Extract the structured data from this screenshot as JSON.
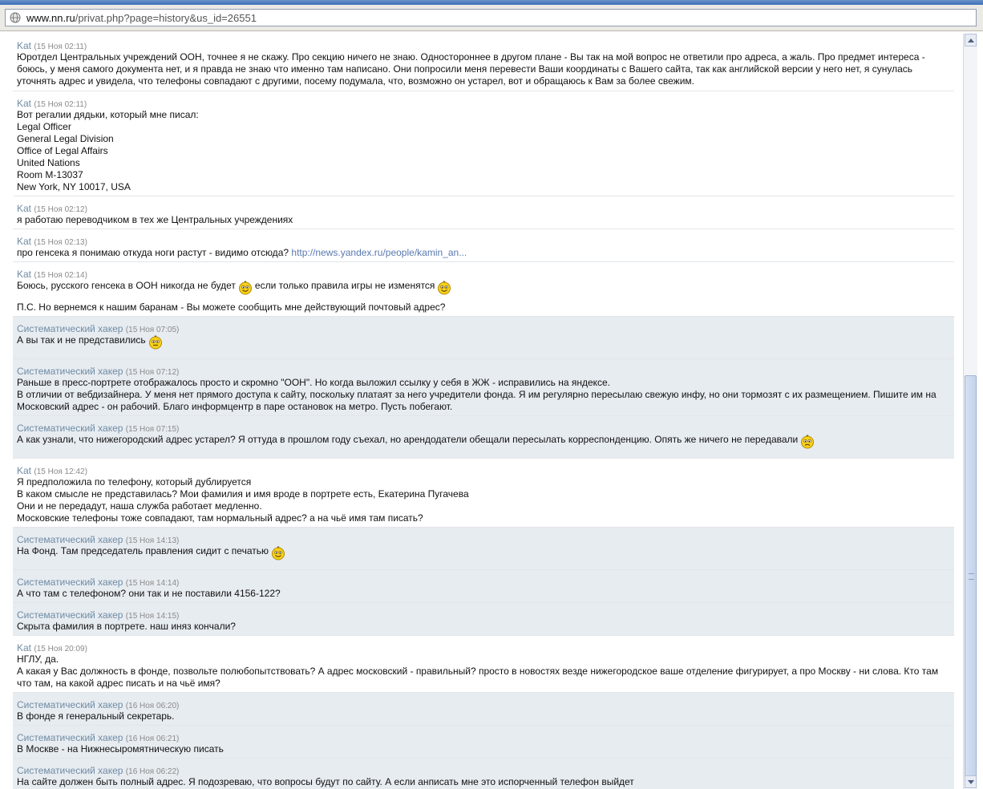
{
  "address_bar": {
    "host": "www.nn.ru",
    "path": "/privat.php?page=history&us_id=26551"
  },
  "messages": [
    {
      "author": "Kat",
      "time": "(15 Ноя 02:11)",
      "kind": "kat",
      "height": 72,
      "lines": [
        {
          "text": "Юротдел Центральных учреждений ООН, точнее я не скажу. Про секцию ничего не знаю. Одностороннее в другом плане - Вы так на мой вопрос не ответили про адреса, а жаль. Про предмет интереса - боюсь, у меня самого документа нет, и я правда не знаю что именно там написано. Они попросили меня перевести Ваши координаты с Вашего сайта, так как английской версии у него нет, я сунулась уточнять адрес и увидела, что телефоны совпадают с другими, посему подумала, что, возможно он устарел, вот и обращаюсь к Вам за более свежим.",
          "wrap": true
        }
      ]
    },
    {
      "author": "Kat",
      "time": "(15 Ноя 02:11)",
      "kind": "kat",
      "height": 131,
      "lines": [
        {
          "text": "Вот регалии дядьки, который мне писал:"
        },
        {
          "text": "Legal Officer"
        },
        {
          "text": "General Legal Division"
        },
        {
          "text": "Office of Legal Affairs"
        },
        {
          "text": "United Nations"
        },
        {
          "text": "Room M-13037"
        },
        {
          "text": "New York, NY 10017, USA"
        }
      ]
    },
    {
      "author": "Kat",
      "time": "(15 Ноя 02:12)",
      "kind": "kat",
      "height": 41,
      "lines": [
        {
          "text": "я работаю переводчиком в тех же Центральных учреждениях"
        }
      ]
    },
    {
      "author": "Kat",
      "time": "(15 Ноя 02:13)",
      "kind": "kat",
      "height": 41,
      "lines": [
        {
          "text": "про генсека я понимаю откуда ноги растут - видимо отсюда?",
          "link": "http://news.yandex.ru/people/kamin_an..."
        }
      ]
    },
    {
      "author": "Kat",
      "time": "(15 Ноя 02:14)",
      "kind": "kat",
      "height": 68,
      "lines": [
        {
          "text": "Боюсь, русского генсека в ООН никогда не будет",
          "smiley": "smile-icon",
          "after": "если только правила игры не изменятся",
          "smiley2": "smile-icon"
        },
        {
          "blank": true
        },
        {
          "text": "П.С. Но вернемся к нашим баранам - Вы можете сообщить мне действующий почтовый адрес?"
        }
      ]
    },
    {
      "author": "Систематический хакер",
      "time": "(15 Ноя 07:05)",
      "kind": "hak",
      "height": 53,
      "lines": [
        {
          "text": "А вы так и не представились",
          "smiley": "confused-icon"
        }
      ]
    },
    {
      "author": "Систематический хакер",
      "time": "(15 Ноя 07:12)",
      "kind": "hak",
      "height": 71,
      "lines": [
        {
          "text": "Раньше в пресс-портрете отображалось просто и скромно \"ООН\". Но когда выложил ссылку у себя в ЖЖ - исправились на яндексе."
        },
        {
          "text": "В отличии от вебдизайнера. У меня нет прямого доступа к сайту, поскольку платаят за него учредители фонда. Я им регулярно пересылаю свежую инфу, но они тормозят с их размещением. Пишите им на Московский адрес - он рабочий. Благо информцентр в паре остановок на метро. Пусть побегают.",
          "wrap": true
        }
      ]
    },
    {
      "author": "Систематический хакер",
      "time": "(15 Ноя 07:15)",
      "kind": "hak",
      "height": 53,
      "lines": [
        {
          "text": "А как узнали, что нижегородский адрес устарел? Я оттуда в прошлом году съехал, но арендодатели обещали пересылать корреспонденцию. Опять же ничего не передавали",
          "smiley": "sad-icon"
        }
      ]
    },
    {
      "author": "Kat",
      "time": "(15 Ноя 12:42)",
      "kind": "kat",
      "height": 86,
      "lines": [
        {
          "text": "Я предположила по телефону, который дублируется"
        },
        {
          "text": "В каком смысле не представилась? Мои фамилия и имя вроде в портрете есть, Екатерина Пугачева"
        },
        {
          "text": "Они и не передадут, наша служба работает медленно."
        },
        {
          "text": "Московские телефоны тоже совпадают, там нормальный адрес? а на чьё имя там писать?"
        }
      ]
    },
    {
      "author": "Систематический хакер",
      "time": "(15 Ноя 14:13)",
      "kind": "hak",
      "height": 53,
      "lines": [
        {
          "text": "На Фонд. Там председатель правления сидит с печатью",
          "smiley": "smile-icon"
        }
      ]
    },
    {
      "author": "Систематический хакер",
      "time": "(15 Ноя 14:14)",
      "kind": "hak",
      "height": 41,
      "lines": [
        {
          "text": "А что там с телефоном? они так и не поставили 4156-122?"
        }
      ]
    },
    {
      "author": "Систематический хакер",
      "time": "(15 Ноя 14:15)",
      "kind": "hak",
      "height": 41,
      "lines": [
        {
          "text": "Скрыта фамилия в портрете. наш иняз кончали?"
        }
      ]
    },
    {
      "author": "Kat",
      "time": "(15 Ноя 20:09)",
      "kind": "kat",
      "height": 71,
      "lines": [
        {
          "text": "НГЛУ, да."
        },
        {
          "text": "А какая у Вас должность в фонде, позвольте полюбопытствовать? А адрес московский - правильный? просто в новостях везде нижегородское ваше отделение фигурирует, а про Москву - ни слова. Кто там что там, на какой адрес писать и на чьё имя?",
          "wrap": true
        }
      ]
    },
    {
      "author": "Систематический хакер",
      "time": "(16 Ноя 06:20)",
      "kind": "hak",
      "height": 41,
      "lines": [
        {
          "text": "В фонде я генеральный секретарь."
        }
      ]
    },
    {
      "author": "Систематический хакер",
      "time": "(16 Ноя 06:21)",
      "kind": "hak",
      "height": 41,
      "lines": [
        {
          "text": "В Москве - на Нижнесыромятническую писать"
        }
      ]
    },
    {
      "author": "Систематический хакер",
      "time": "(16 Ноя 06:22)",
      "kind": "hak",
      "height": 40,
      "lines": [
        {
          "text": "На сайте должен быть полный адрес. Я подозреваю, что вопросы будут по сайту. А если анписать мне это испорченный телефон выйдет"
        }
      ]
    }
  ]
}
